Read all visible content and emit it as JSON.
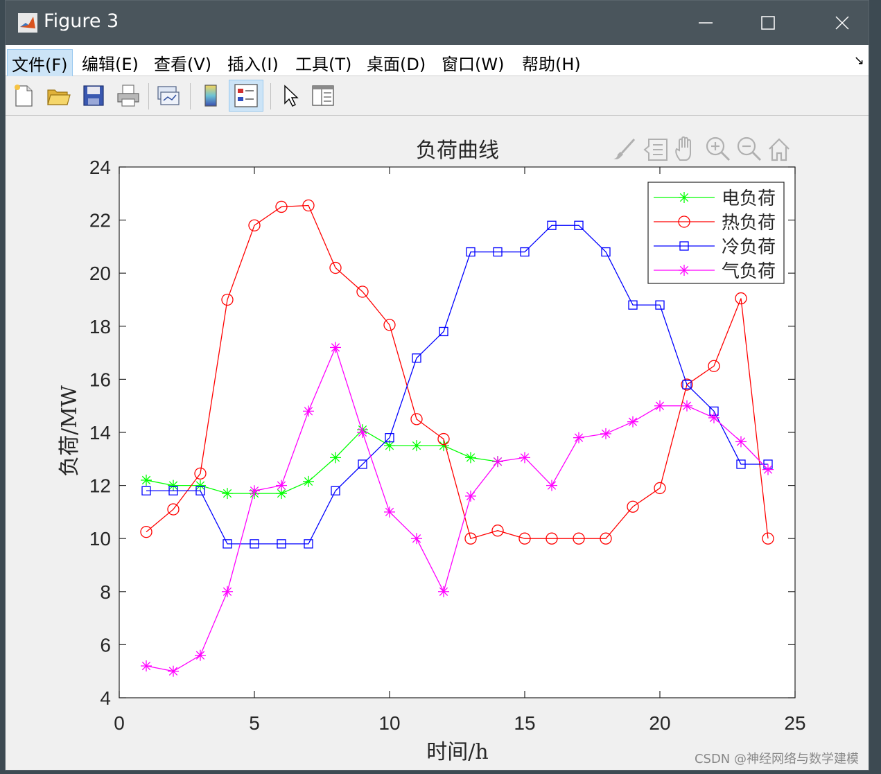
{
  "window": {
    "title": "Figure 3",
    "app_icon": "matlab-icon",
    "controls": [
      "minimize-icon",
      "maximize-icon",
      "close-icon"
    ]
  },
  "menu": {
    "items": [
      {
        "label": "文件(F)",
        "active": true
      },
      {
        "label": "编辑(E)"
      },
      {
        "label": "查看(V)"
      },
      {
        "label": "插入(I)"
      },
      {
        "label": "工具(T)"
      },
      {
        "label": "桌面(D)"
      },
      {
        "label": "窗口(W)"
      },
      {
        "label": "帮助(H)"
      }
    ],
    "overflow_icon": "dock-arrow-icon"
  },
  "toolbar": {
    "buttons": [
      "new-figure-icon",
      "open-file-icon",
      "save-icon",
      "print-icon",
      "link-plot-icon",
      "insert-colorbar-icon",
      "insert-legend-icon",
      "edit-plot-icon",
      "property-inspector-icon"
    ]
  },
  "axes_toolbar": {
    "icons": [
      "brush-icon",
      "data-tip-icon",
      "pan-icon",
      "zoom-in-icon",
      "zoom-out-icon",
      "home-icon"
    ]
  },
  "chart_data": {
    "type": "line",
    "title": "负荷曲线",
    "xlabel": "时间/h",
    "ylabel": "负荷/MW",
    "xlim": [
      0,
      25
    ],
    "ylim": [
      4,
      24
    ],
    "xticks": [
      0,
      5,
      10,
      15,
      20,
      25
    ],
    "yticks": [
      4,
      6,
      8,
      10,
      12,
      14,
      16,
      18,
      20,
      22,
      24
    ],
    "grid": false,
    "legend_position": "top-right",
    "x": [
      1,
      2,
      3,
      4,
      5,
      6,
      7,
      8,
      9,
      10,
      11,
      12,
      13,
      14,
      15,
      16,
      17,
      18,
      19,
      20,
      21,
      22,
      23,
      24
    ],
    "series": [
      {
        "name": "电负荷",
        "color": "#00ff00",
        "marker": "star",
        "values": [
          12.2,
          12.0,
          12.0,
          11.7,
          11.7,
          11.7,
          12.15,
          13.05,
          14.1,
          13.5,
          13.5,
          13.5,
          13.05,
          12.9,
          null,
          null,
          null,
          null,
          null,
          null,
          null,
          null,
          null,
          null
        ]
      },
      {
        "name": "热负荷",
        "color": "#ff0000",
        "marker": "circle",
        "values": [
          10.25,
          11.1,
          12.45,
          19.0,
          21.8,
          22.5,
          22.55,
          20.2,
          19.3,
          18.05,
          14.5,
          13.75,
          10.0,
          10.3,
          10.0,
          10.0,
          10.0,
          10.0,
          11.2,
          11.9,
          15.8,
          16.5,
          19.05,
          10.0
        ]
      },
      {
        "name": "冷负荷",
        "color": "#0000ff",
        "marker": "square",
        "values": [
          11.8,
          11.8,
          11.8,
          9.8,
          9.8,
          9.8,
          9.8,
          11.8,
          12.8,
          13.8,
          16.8,
          17.8,
          20.8,
          20.8,
          20.8,
          21.8,
          21.8,
          20.8,
          18.8,
          18.8,
          15.8,
          14.8,
          12.8,
          12.8
        ]
      },
      {
        "name": "气负荷",
        "color": "#ff00ff",
        "marker": "star",
        "values": [
          5.2,
          5.0,
          5.6,
          8.0,
          11.8,
          12.0,
          14.8,
          17.2,
          14.0,
          11.0,
          10.0,
          8.0,
          11.6,
          12.9,
          13.05,
          12.0,
          13.8,
          13.95,
          14.4,
          15.0,
          15.0,
          14.55,
          13.65,
          12.6
        ]
      }
    ]
  },
  "watermark": "CSDN @神经网络与数学建模"
}
